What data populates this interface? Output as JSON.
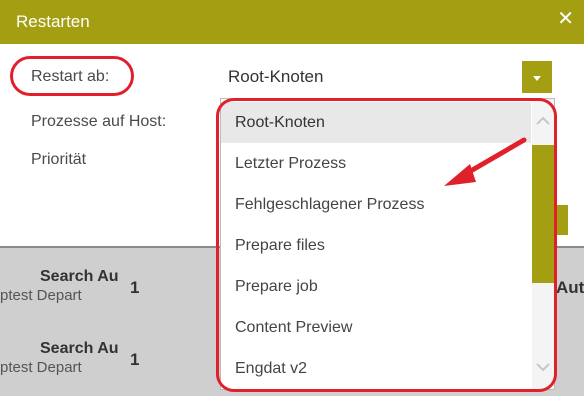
{
  "dialog": {
    "title": "Restarten",
    "close_glyph": "✕",
    "restart_label": "Restart ab:",
    "host_label": "Prozesse auf Host:",
    "priority_label": "Priorität",
    "selected_value": "Root-Knoten"
  },
  "dropdown": {
    "options": [
      "Root-Knoten",
      "Letzter Prozess",
      "Fehlgeschlagener Prozess",
      "Prepare files",
      "Prepare job",
      "Content Preview",
      "Engdat v2"
    ]
  },
  "background_rows": [
    {
      "name": "Search Au",
      "sub": "ptest Depart",
      "count": "1"
    },
    {
      "name": "Search Au",
      "sub": "ptest Depart",
      "count": "1"
    }
  ],
  "background_partial": "Aut",
  "colors": {
    "accent": "#a39e12",
    "annotation": "#e0202a"
  }
}
